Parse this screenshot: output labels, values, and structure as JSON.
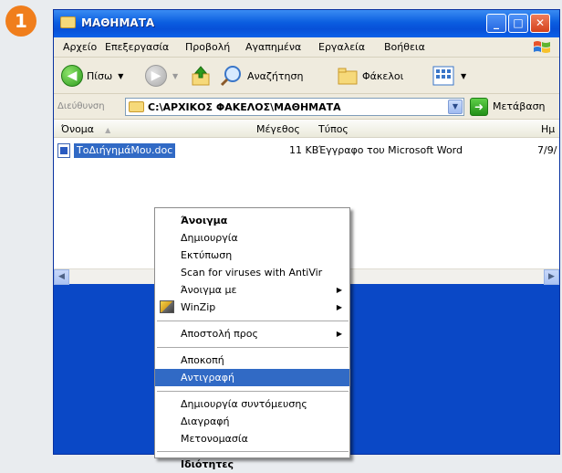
{
  "step_badge": "1",
  "window": {
    "title": "ΜΑΘΗΜΑΤΑ",
    "minimize": "_",
    "maximize": "□",
    "close": "✕"
  },
  "menubar": {
    "items": [
      "Αρχείο",
      "Επεξεργασία",
      "Προβολή",
      "Αγαπημένα",
      "Εργαλεία",
      "Βοήθεια"
    ]
  },
  "toolbar": {
    "back_label": "Πίσω",
    "search_label": "Αναζήτηση",
    "folders_label": "Φάκελοι"
  },
  "addressbar": {
    "label": "Διεύθυνση",
    "path": "C:\\ΑΡΧΙΚΟΣ ΦΑΚΕΛΟΣ\\ΜΑΘΗΜΑΤΑ",
    "go_label": "Μετάβαση"
  },
  "listview": {
    "columns": {
      "name": "Όνομα",
      "size": "Μέγεθος",
      "type": "Τύπος",
      "modified": "Ημ"
    },
    "file": {
      "name": "ΤοΔιήγημάΜου.doc",
      "size": "11 KB",
      "type": "Έγγραφο του Microsoft Word",
      "modified": "7/9/"
    }
  },
  "context_menu": {
    "items": {
      "open": "Άνοιγμα",
      "new": "Δημιουργία",
      "print": "Εκτύπωση",
      "scan": "Scan for viruses with AntiVir",
      "open_with": "Άνοιγμα με",
      "winzip": "WinZip",
      "send_to": "Αποστολή προς",
      "cut": "Αποκοπή",
      "copy": "Αντιγραφή",
      "create_shortcut": "Δημιουργία συντόμευσης",
      "delete": "Διαγραφή",
      "rename": "Μετονομασία",
      "properties": "Ιδιότητες"
    },
    "highlighted": "copy"
  },
  "colors": {
    "title_bar": "#0b5ee0",
    "selection": "#316ac5",
    "window_body": "#0a48c6",
    "badge": "#f07e1c"
  }
}
